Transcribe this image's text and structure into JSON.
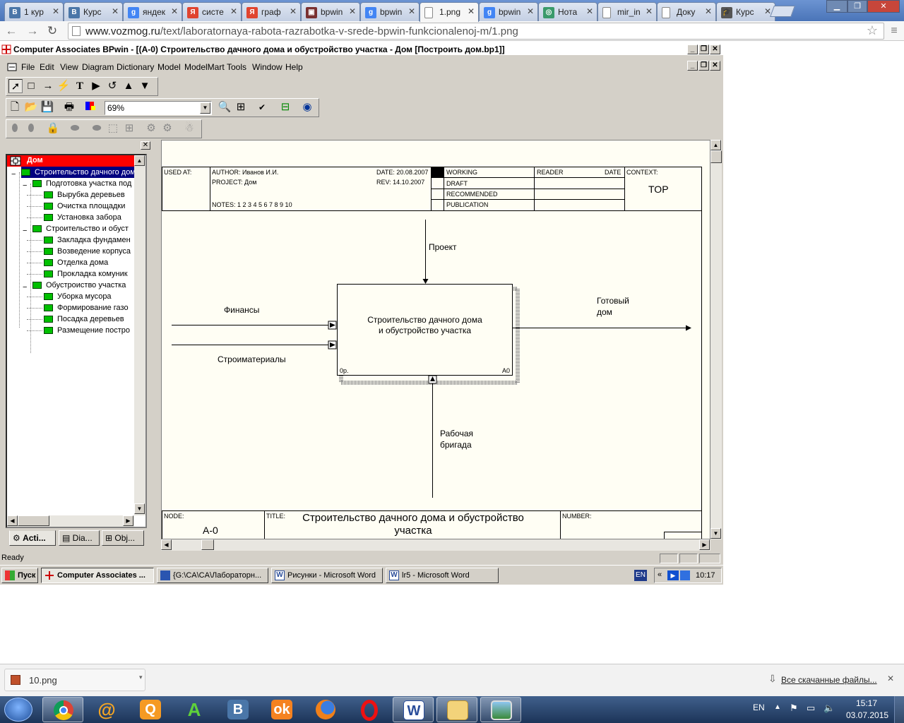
{
  "browser": {
    "tabs": [
      {
        "label": "1 кур",
        "icon": "vk-icon",
        "color": "#4a76a8",
        "glyph": "B"
      },
      {
        "label": "Курс",
        "icon": "vk-icon",
        "color": "#4a76a8",
        "glyph": "B"
      },
      {
        "label": "яндек",
        "icon": "google-icon",
        "color": "#4285f4",
        "glyph": "g"
      },
      {
        "label": "систе",
        "icon": "yandex-icon",
        "color": "#e0442f",
        "glyph": "Я"
      },
      {
        "label": "граф",
        "icon": "yandex-icon",
        "color": "#e0442f",
        "glyph": "Я"
      },
      {
        "label": "bpwin",
        "icon": "image-icon",
        "color": "#7a3030",
        "glyph": "▣"
      },
      {
        "label": "bpwin",
        "icon": "google-icon",
        "color": "#4285f4",
        "glyph": "g"
      },
      {
        "label": "1.png",
        "icon": "page-icon",
        "color": "#ffffff",
        "glyph": ""
      },
      {
        "label": "bpwin",
        "icon": "google-icon",
        "color": "#4285f4",
        "glyph": "g"
      },
      {
        "label": "Нота",
        "icon": "globe-icon",
        "color": "#3a9a6a",
        "glyph": "◎"
      },
      {
        "label": "mir_in",
        "icon": "page-icon",
        "color": "#ffffff",
        "glyph": ""
      },
      {
        "label": "Доку",
        "icon": "page-icon",
        "color": "#ffffff",
        "glyph": ""
      },
      {
        "label": "Курс",
        "icon": "grad-cap-icon",
        "color": "#555555",
        "glyph": "🎓"
      }
    ],
    "url_domain": "www.vozmog.ru",
    "url_path": "/text/laboratornaya-rabota-razrabotka-v-srede-bpwin-funkcionalenoj-m/1.png"
  },
  "app": {
    "title": "Computer Associates BPwin - [(A-0) Строительство дачного дома  и обустройство участка  - Дом  [Построить дом.bp1]]",
    "menu": [
      "File",
      "Edit",
      "View",
      "Diagram",
      "Dictionary",
      "Model",
      "ModelMart",
      "Tools",
      "Window",
      "Help"
    ],
    "zoom": "69%",
    "status": "Ready"
  },
  "explorer": {
    "root": "Дом",
    "items": [
      {
        "label": "Строительство дачного дома",
        "level": 1
      },
      {
        "label": "Подготовка участка под",
        "level": 2
      },
      {
        "label": "Вырубка деревьев",
        "level": 3
      },
      {
        "label": "Очистка площадки",
        "level": 3
      },
      {
        "label": "Установка забора",
        "level": 3
      },
      {
        "label": "Строительство  и обуст",
        "level": 2
      },
      {
        "label": "Закладка фундамен",
        "level": 3
      },
      {
        "label": "Возведение корпуса",
        "level": 3
      },
      {
        "label": "Отделка дома",
        "level": 3
      },
      {
        "label": "Прокладка комуник",
        "level": 3
      },
      {
        "label": "Обустроиство участка",
        "level": 2
      },
      {
        "label": "Уборка мусора",
        "level": 3
      },
      {
        "label": "Формирование газо",
        "level": 3
      },
      {
        "label": "Посадка деревьев",
        "level": 3
      },
      {
        "label": "Размещение постро",
        "level": 3
      }
    ],
    "tabs": [
      "Acti...",
      "Dia...",
      "Obj..."
    ]
  },
  "diagram": {
    "header": {
      "used_at": "USED AT:",
      "author": "AUTHOR:  Иванов И.И.",
      "project": "PROJECT:  Дом",
      "notes": "NOTES:  1  2  3  4  5  6  7  8  9  10",
      "date": "DATE: 20.08.2007",
      "rev": "REV:   14.10.2007",
      "working": "WORKING",
      "draft": "DRAFT",
      "recommended": "RECOMMENDED",
      "publication": "PUBLICATION",
      "reader": "READER",
      "reader_date": "DATE",
      "context": "CONTEXT:",
      "context_value": "TOP"
    },
    "box_title_1": "Строительство дачного дома",
    "box_title_2": "и обустройство участка",
    "box_cost": "0р.",
    "box_id": "A0",
    "arrows": {
      "control": "Проект",
      "input1": "Финансы",
      "input2": "Строиматериалы",
      "output_1": "Готовый",
      "output_2": "дом",
      "mechanism_1": "Рабочая",
      "mechanism_2": "бригада"
    },
    "footer": {
      "node_label": "NODE:",
      "node_value": "A-0",
      "title_label": "TITLE:",
      "title_value_1": "Строительство дачного дома  и обустройство",
      "title_value_2": "участка",
      "number_label": "NUMBER:"
    }
  },
  "xp_taskbar": {
    "start": "Пуск",
    "buttons": [
      "Computer Associates ...",
      "{G:\\CA\\CA\\Лабораторн...",
      "Рисунки - Microsoft Word",
      "lr5 - Microsoft Word"
    ],
    "lang": "EN",
    "time": "10:17"
  },
  "downloads": {
    "file": "10.png",
    "all_link": "Все скачанные файлы..."
  },
  "win7": {
    "lang": "EN",
    "time": "15:17",
    "date": "03.07.2015"
  }
}
